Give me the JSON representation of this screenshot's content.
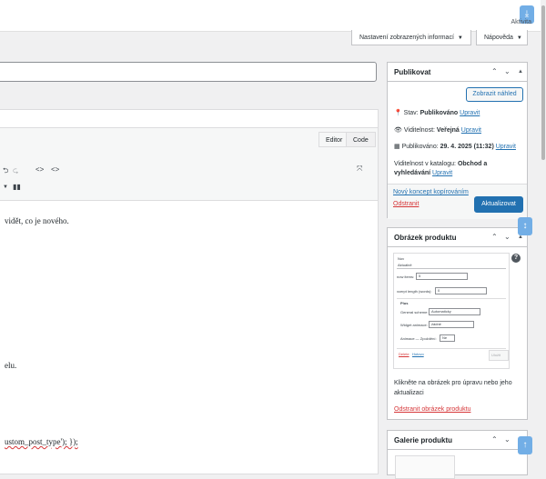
{
  "topbar": {
    "activity_label": "Aktivita"
  },
  "screen_options": {
    "label": "Nastavení zobrazených informací",
    "caret": "▼"
  },
  "help": {
    "label": "Nápověda",
    "caret": "▼"
  },
  "editor": {
    "tab_editor": "Editor",
    "tab_code": "Code",
    "content_lines": [
      "vidět, co je nového.",
      "elu.",
      "ustom_post_type'); });"
    ]
  },
  "publish_box": {
    "title": "Publikovat",
    "preview_button": "Zobrazit náhled",
    "status_label": "Stav:",
    "status_value": "Publikováno",
    "visibility_label": "Viditelnost:",
    "visibility_value": "Veřejná",
    "published_label": "Publikováno:",
    "published_value": "29. 4. 2025 (11:32)",
    "edit_link": "Upravit",
    "catalog_visibility_label": "Viditelnost v katalogu:",
    "catalog_visibility_value": "Obchod a vyhledávání",
    "copy_link": "Nový koncept kopírováním",
    "trash_link": "Odstranit",
    "update_button": "Aktualizovat"
  },
  "product_image_box": {
    "title": "Obrázek produktu",
    "help_icon": "?",
    "hint": "Klikněte na obrázek pro úpravu nebo jeho aktualizaci",
    "remove_link": "Odstranit obrázek produktu",
    "thumb_text": {
      "l1": "Nov",
      "l2": "Aktuálně",
      "l3": "now items:",
      "l4": "5",
      "l5": "xcerpt length (words):",
      "l6": "0",
      "l7": "Plus",
      "l8": "General scheme:",
      "l9": "Automaticky",
      "l10": "Widget animace:",
      "l11": "žádné",
      "l12": "Animace — Zpoždění:",
      "l13": "Ne",
      "l14": "Delete",
      "l15": "Hotovo",
      "l16": "Uložit"
    }
  },
  "gallery_box": {
    "title": "Galerie produktu"
  },
  "icons": [
    "help-icon",
    "chevron-up-icon",
    "chevron-down-icon",
    "eye-icon",
    "calendar-icon",
    "pin-icon",
    "undo-icon",
    "code-icon",
    "fullscreen-icon",
    "binoculars-icon"
  ]
}
